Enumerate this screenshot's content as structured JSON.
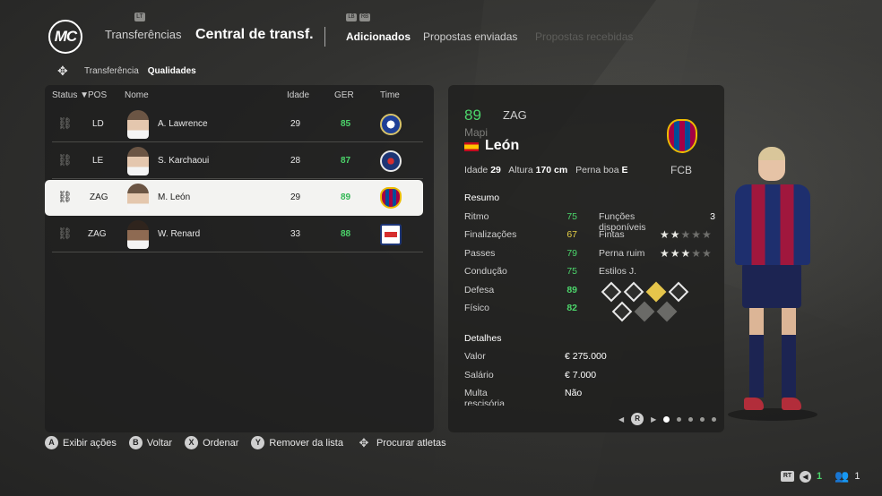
{
  "header": {
    "logo": "MC",
    "lb_hint": "LT",
    "breadcrumb": "Transferências",
    "title": "Central de transf.",
    "tab_hints": [
      "LB",
      "RB"
    ],
    "tabs": [
      {
        "label": "Adicionados",
        "state": "active"
      },
      {
        "label": "Propostas enviadas",
        "state": "normal"
      },
      {
        "label": "Propostas recebidas",
        "state": "disabled"
      }
    ]
  },
  "subnav": {
    "items": [
      {
        "label": "Transferência",
        "active": false
      },
      {
        "label": "Qualidades",
        "active": true
      }
    ]
  },
  "table": {
    "columns": {
      "status": "Status ▼",
      "pos": "POS",
      "name": "Nome",
      "age": "Idade",
      "ger": "GER",
      "team": "Time"
    },
    "rows": [
      {
        "pos": "LD",
        "name": "A. Lawrence",
        "age": "29",
        "ger": "85",
        "team": "chelsea"
      },
      {
        "pos": "LE",
        "name": "S. Karchaoui",
        "age": "28",
        "ger": "87",
        "team": "psg"
      },
      {
        "pos": "ZAG",
        "name": "M. León",
        "age": "29",
        "ger": "89",
        "team": "barca"
      },
      {
        "pos": "ZAG",
        "name": "W. Renard",
        "age": "33",
        "ger": "88",
        "team": "lyon"
      }
    ]
  },
  "detail": {
    "ovr": "89",
    "pos": "ZAG",
    "first_name": "Mapi",
    "last_name": "León",
    "club": "FCB",
    "bio": {
      "age_label": "Idade",
      "age": "29",
      "height_label": "Altura",
      "height": "170 cm",
      "foot_label": "Perna boa",
      "foot": "E"
    },
    "summary_title": "Resumo",
    "attributes": [
      {
        "label": "Ritmo",
        "value": "75"
      },
      {
        "label": "Finalizações",
        "value": "67"
      },
      {
        "label": "Passes",
        "value": "79"
      },
      {
        "label": "Condução",
        "value": "75"
      },
      {
        "label": "Defesa",
        "value": "89"
      },
      {
        "label": "Físico",
        "value": "82"
      }
    ],
    "extras": {
      "functions_label": "Funções disponíveis",
      "functions_value": "3",
      "skill_moves_label": "Fintas",
      "skill_moves_stars": 2,
      "weak_foot_label": "Perna ruim",
      "weak_foot_stars": 3,
      "playstyles_label": "Estilos J."
    },
    "finance_title": "Detalhes financeiros",
    "finance": [
      {
        "label": "Valor",
        "value": "€ 275.000"
      },
      {
        "label": "Salário",
        "value": "€ 7.000"
      },
      {
        "label": "Multa rescisória",
        "value": "Não"
      }
    ],
    "pager": {
      "button": "R",
      "pages": 5,
      "current": 1
    }
  },
  "hints": [
    {
      "btn": "A",
      "label": "Exibir ações"
    },
    {
      "btn": "B",
      "label": "Voltar"
    },
    {
      "btn": "X",
      "label": "Ordenar"
    },
    {
      "btn": "Y",
      "label": "Remover da lista"
    },
    {
      "btn": "",
      "label": "Procurar atletas"
    }
  ],
  "corner": {
    "rt": "RT",
    "count_green": "1",
    "users_count": "1"
  },
  "colors": {
    "green": "#4cd66b",
    "yellow": "#e5cf46",
    "selected_row": "#f3f3f1"
  }
}
